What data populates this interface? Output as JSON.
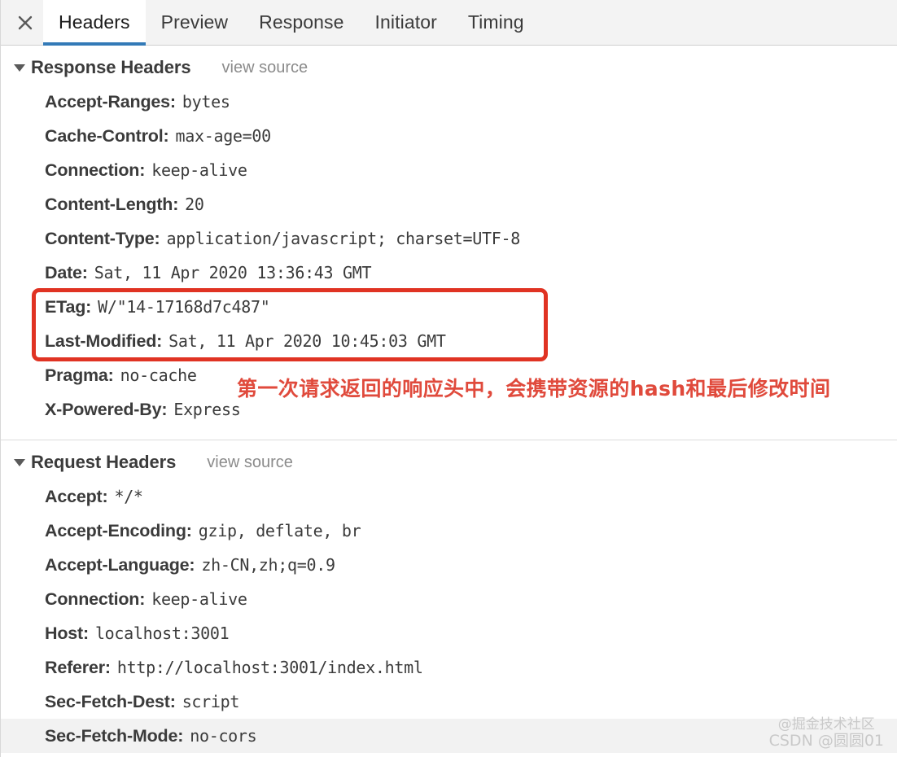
{
  "tabs": {
    "close_label": "×",
    "items": [
      {
        "label": "Headers",
        "active": true
      },
      {
        "label": "Preview",
        "active": false
      },
      {
        "label": "Response",
        "active": false
      },
      {
        "label": "Initiator",
        "active": false
      },
      {
        "label": "Timing",
        "active": false
      }
    ]
  },
  "response_section": {
    "title": "Response Headers",
    "view_source": "view source",
    "headers": [
      {
        "name": "Accept-Ranges:",
        "value": "bytes"
      },
      {
        "name": "Cache-Control:",
        "value": "max-age=00"
      },
      {
        "name": "Connection:",
        "value": "keep-alive"
      },
      {
        "name": "Content-Length:",
        "value": "20"
      },
      {
        "name": "Content-Type:",
        "value": "application/javascript; charset=UTF-8"
      },
      {
        "name": "Date:",
        "value": "Sat, 11 Apr 2020 13:36:43 GMT"
      },
      {
        "name": "ETag:",
        "value": "W/\"14-17168d7c487\""
      },
      {
        "name": "Last-Modified:",
        "value": "Sat, 11 Apr 2020 10:45:03 GMT"
      },
      {
        "name": "Pragma:",
        "value": "no-cache"
      },
      {
        "name": "X-Powered-By:",
        "value": "Express"
      }
    ]
  },
  "request_section": {
    "title": "Request Headers",
    "view_source": "view source",
    "headers": [
      {
        "name": "Accept:",
        "value": "*/*"
      },
      {
        "name": "Accept-Encoding:",
        "value": "gzip, deflate, br"
      },
      {
        "name": "Accept-Language:",
        "value": "zh-CN,zh;q=0.9"
      },
      {
        "name": "Connection:",
        "value": "keep-alive"
      },
      {
        "name": "Host:",
        "value": "localhost:3001"
      },
      {
        "name": "Referer:",
        "value": "http://localhost:3001/index.html"
      },
      {
        "name": "Sec-Fetch-Dest:",
        "value": "script"
      },
      {
        "name": "Sec-Fetch-Mode:",
        "value": "no-cors"
      }
    ]
  },
  "annotation": {
    "text": "第一次请求返回的响应头中，会携带资源的hash和最后修改时间",
    "color": "#e04a3c"
  },
  "highlight_box": {
    "color": "#e03323",
    "covers": [
      "ETag",
      "Last-Modified"
    ]
  },
  "watermark": {
    "line1": "@掘金技术社区",
    "line2": "CSDN @圆圆01"
  },
  "accent": {
    "active_tab_underline": "#337ab7"
  }
}
